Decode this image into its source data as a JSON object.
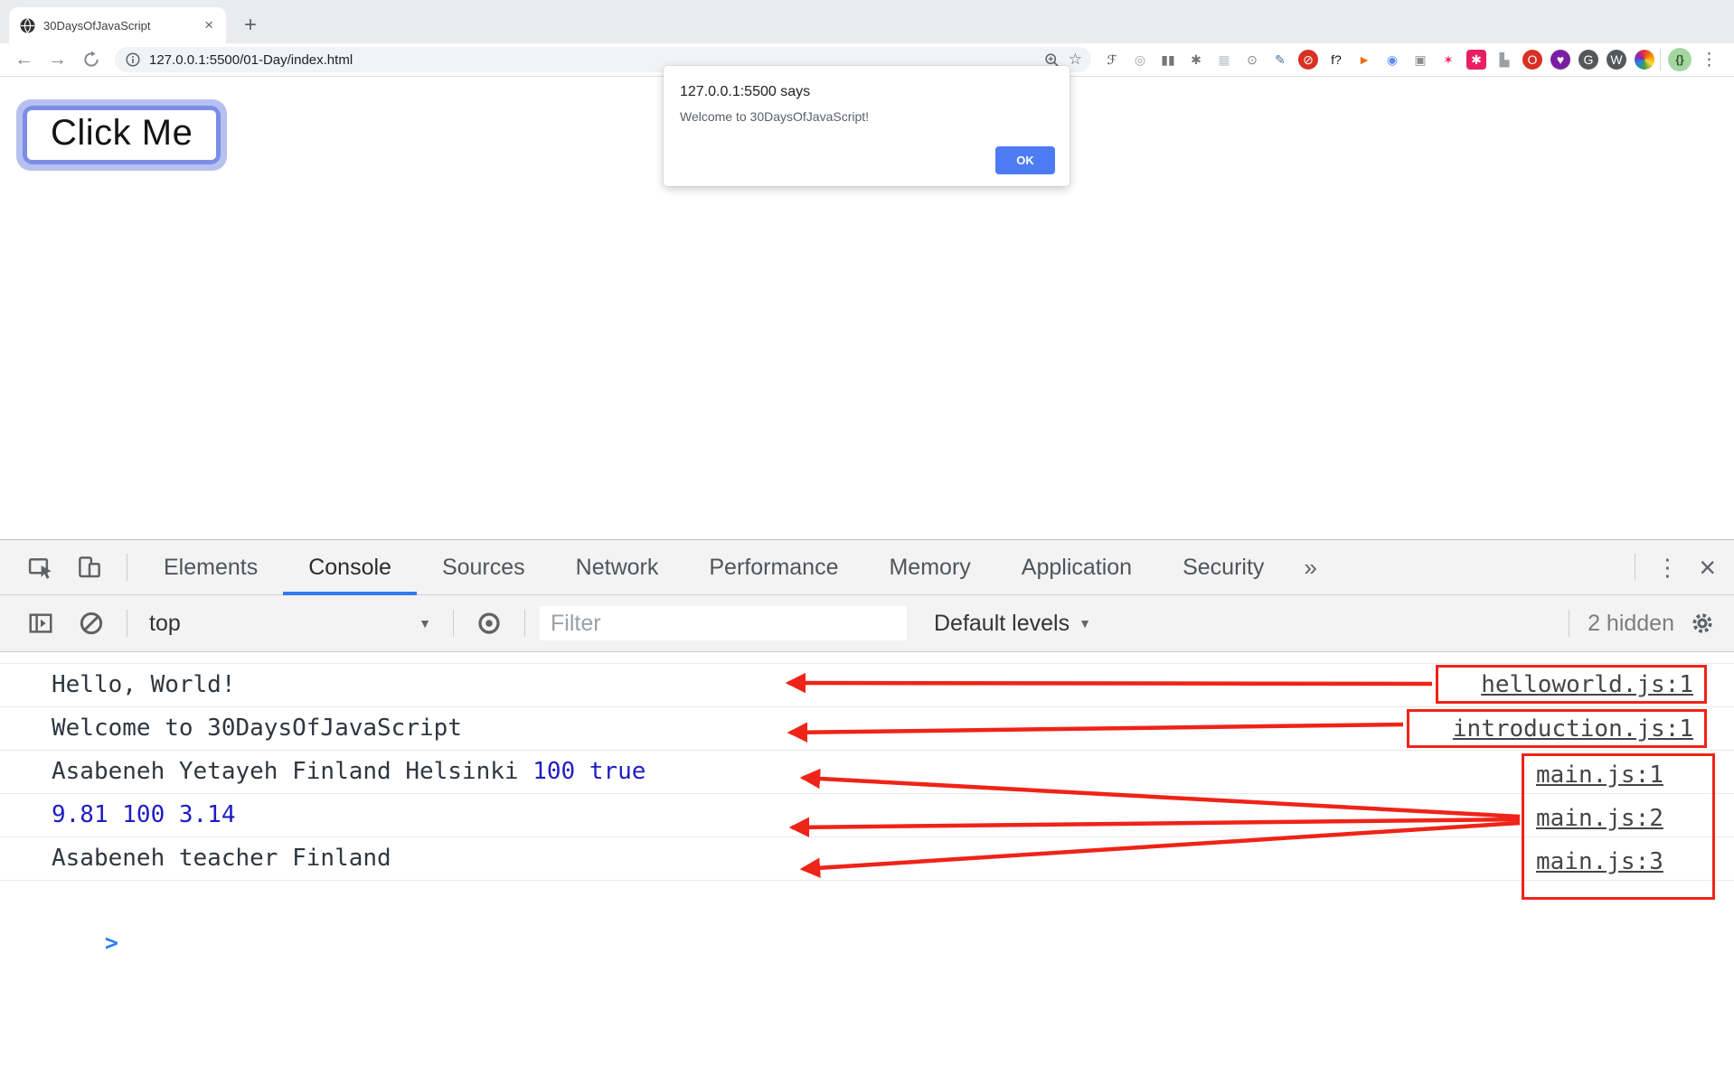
{
  "browser": {
    "tab_title": "30DaysOfJavaScript",
    "url": "127.0.0.1:5500/01-Day/index.html",
    "extensions": [
      {
        "name": "script-f",
        "glyph": "ℱ",
        "fg": "#3c4043",
        "bg": ""
      },
      {
        "name": "target",
        "glyph": "◎",
        "fg": "#9aa0a6",
        "bg": ""
      },
      {
        "name": "columns",
        "glyph": "▮▮",
        "fg": "#757575",
        "bg": ""
      },
      {
        "name": "bug",
        "glyph": "✱",
        "fg": "#757575",
        "bg": ""
      },
      {
        "name": "grid",
        "glyph": "▦",
        "fg": "#c0c4c9",
        "bg": ""
      },
      {
        "name": "parens",
        "glyph": "⊙",
        "fg": "#80868b",
        "bg": ""
      },
      {
        "name": "eyedropper",
        "glyph": "✎",
        "fg": "#4a7096",
        "bg": ""
      },
      {
        "name": "stop",
        "glyph": "⊘",
        "fg": "#ffffff",
        "bg": "#d93025",
        "round": true
      },
      {
        "name": "f-question",
        "glyph": "f?",
        "fg": "#111111",
        "bg": ""
      },
      {
        "name": "megaphone",
        "glyph": "►",
        "fg": "#e8710a",
        "bg": ""
      },
      {
        "name": "ring",
        "glyph": "◉",
        "fg": "#5b8def",
        "bg": ""
      },
      {
        "name": "camera",
        "glyph": "▣",
        "fg": "#8a8f94",
        "bg": ""
      },
      {
        "name": "star-six",
        "glyph": "✶",
        "fg": "#e91e63",
        "bg": ""
      },
      {
        "name": "settings-square",
        "glyph": "✱",
        "fg": "#ffffff",
        "bg": "#e91e63"
      },
      {
        "name": "pedestal",
        "glyph": "▙",
        "fg": "#9aa0a6",
        "bg": ""
      },
      {
        "name": "o-app",
        "glyph": "O",
        "fg": "#ffffff",
        "bg": "#d93025",
        "round": true
      },
      {
        "name": "heart-search",
        "glyph": "♥",
        "fg": "#ffffff",
        "bg": "#7b1fa2",
        "round": true
      },
      {
        "name": "g-circle",
        "glyph": "G",
        "fg": "#ffffff",
        "bg": "#54575b",
        "round": true
      },
      {
        "name": "w-circle",
        "glyph": "W",
        "fg": "#ffffff",
        "bg": "#54575b",
        "round": true
      },
      {
        "name": "rainbow-circle",
        "glyph": "",
        "fg": "",
        "bg": "rainbow",
        "round": true
      }
    ]
  },
  "page": {
    "button_label": "Click Me"
  },
  "dialog": {
    "title": "127.0.0.1:5500 says",
    "message": "Welcome to 30DaysOfJavaScript!",
    "ok_label": "OK"
  },
  "devtools": {
    "tabs": [
      {
        "label": "Elements",
        "active": false
      },
      {
        "label": "Console",
        "active": true
      },
      {
        "label": "Sources",
        "active": false
      },
      {
        "label": "Network",
        "active": false
      },
      {
        "label": "Performance",
        "active": false
      },
      {
        "label": "Memory",
        "active": false
      },
      {
        "label": "Application",
        "active": false
      },
      {
        "label": "Security",
        "active": false
      }
    ],
    "toolbar": {
      "context_label": "top",
      "filter_placeholder": "Filter",
      "levels_label": "Default levels",
      "hidden_label": "2 hidden"
    },
    "console": {
      "rows": [
        {
          "segments": [
            {
              "text": "Hello, World!",
              "style": "plain"
            }
          ],
          "source": "helloworld.js:1"
        },
        {
          "segments": [
            {
              "text": "Welcome to 30DaysOfJavaScript",
              "style": "plain"
            }
          ],
          "source": "introduction.js:1"
        },
        {
          "segments": [
            {
              "text": "Asabeneh Yetayeh Finland Helsinki ",
              "style": "plain"
            },
            {
              "text": "100",
              "style": "value"
            },
            {
              "text": " ",
              "style": "plain"
            },
            {
              "text": "true",
              "style": "value"
            }
          ],
          "source": "main.js:1"
        },
        {
          "segments": [
            {
              "text": "9.81 100 3.14",
              "style": "value"
            }
          ],
          "source": "main.js:2"
        },
        {
          "segments": [
            {
              "text": "Asabeneh teacher Finland",
              "style": "plain"
            }
          ],
          "source": "main.js:3"
        }
      ]
    }
  },
  "glyphs": {
    "new_tab": "+",
    "tab_close": "×",
    "more_tabs": "»",
    "menu_kebab": "⋮",
    "devtools_close": "×",
    "dropdown_arrow": "▼",
    "star": "☆",
    "prompt": ">",
    "avatar": "{}",
    "back": "←",
    "forward": "→"
  },
  "colors": {
    "annotation_red": "#ef2318",
    "value_blue": "#1d1dc4",
    "accent_blue": "#3778f0",
    "ok_button_blue": "#4d7bf3",
    "prompt_blue": "#2e7cf6"
  }
}
